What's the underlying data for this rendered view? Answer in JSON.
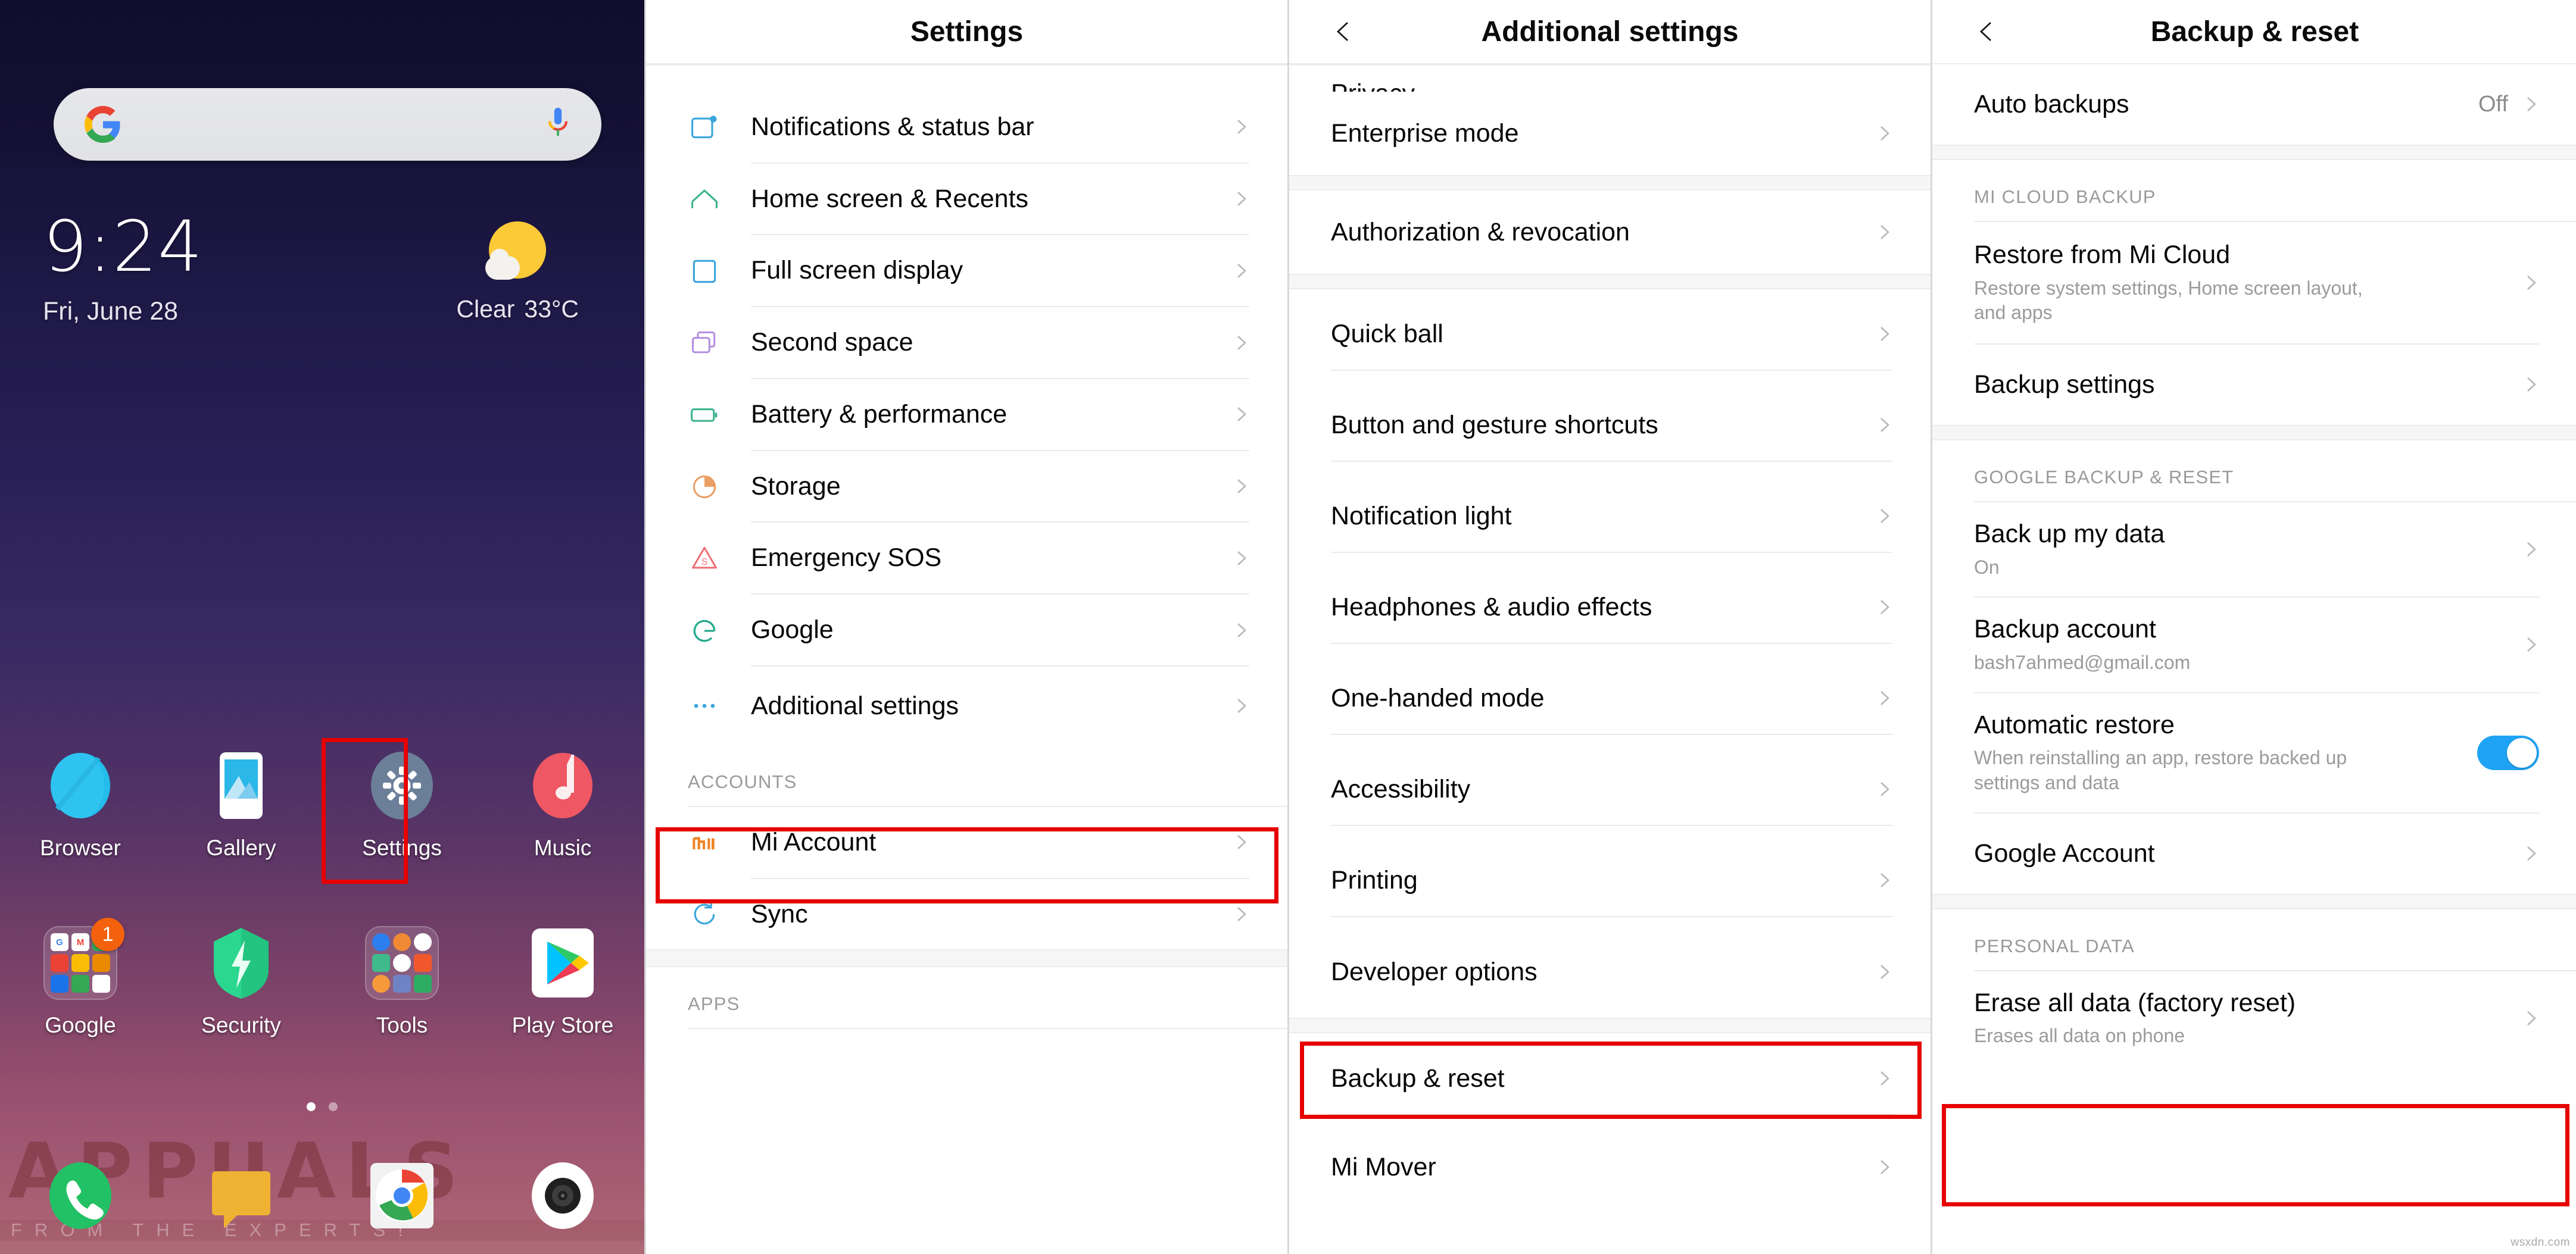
{
  "home": {
    "search": {
      "placeholder": "",
      "google_icon": "google-g-icon",
      "mic_icon": "microphone-icon"
    },
    "clock": {
      "time": "9:24",
      "date": "Fri, June 28"
    },
    "weather": {
      "condition": "Clear",
      "temperature": "33°C",
      "icon": "sun-behind-cloud-icon"
    },
    "apps_row1": [
      {
        "label": "Browser",
        "icon": "browser-icon"
      },
      {
        "label": "Gallery",
        "icon": "gallery-icon"
      },
      {
        "label": "Settings",
        "icon": "settings-gear-icon",
        "highlighted": true
      },
      {
        "label": "Music",
        "icon": "music-note-icon"
      }
    ],
    "apps_row2": [
      {
        "label": "Google",
        "icon": "google-folder-icon",
        "badge": "1"
      },
      {
        "label": "Security",
        "icon": "security-shield-icon"
      },
      {
        "label": "Tools",
        "icon": "tools-folder-icon"
      },
      {
        "label": "Play Store",
        "icon": "play-store-icon"
      }
    ],
    "dock": [
      {
        "label": "Phone",
        "icon": "phone-icon"
      },
      {
        "label": "Messaging",
        "icon": "messaging-icon"
      },
      {
        "label": "Chrome",
        "icon": "chrome-icon"
      },
      {
        "label": "Camera",
        "icon": "camera-icon"
      }
    ],
    "page_dots": {
      "count": 2,
      "active_index": 0
    },
    "watermark": {
      "main": "APPUALS",
      "sub": "FROM THE EXPERTS!"
    }
  },
  "settings": {
    "title": "Settings",
    "items": [
      {
        "label": "Notifications & status bar",
        "icon": "notifications-icon",
        "icon_color": "#3aa6dd"
      },
      {
        "label": "Home screen & Recents",
        "icon": "home-icon",
        "icon_color": "#3fb392"
      },
      {
        "label": "Full screen display",
        "icon": "full-screen-icon",
        "icon_color": "#3aa6dd"
      },
      {
        "label": "Second space",
        "icon": "second-space-icon",
        "icon_color": "#b18ce0"
      },
      {
        "label": "Battery & performance",
        "icon": "battery-icon",
        "icon_color": "#3fb392"
      },
      {
        "label": "Storage",
        "icon": "storage-pie-icon",
        "icon_color": "#eb9d63"
      },
      {
        "label": "Emergency SOS",
        "icon": "emergency-sos-icon",
        "icon_color": "#ef6d72"
      },
      {
        "label": "Google",
        "icon": "google-g-icon",
        "icon_color": "#27ab8f"
      },
      {
        "label": "Additional settings",
        "icon": "ellipsis-icon",
        "icon_color": "#3aa6dd",
        "highlighted": true
      }
    ],
    "section_accounts": "ACCOUNTS",
    "accounts_items": [
      {
        "label": "Mi Account",
        "icon": "mi-logo-icon",
        "icon_color": "#f08223"
      },
      {
        "label": "Sync",
        "icon": "sync-icon",
        "icon_color": "#3aa6dd"
      }
    ],
    "section_apps": "APPS"
  },
  "additional_settings": {
    "title": "Additional settings",
    "back_icon": "chevron-left-icon",
    "items_group1": [
      {
        "label": "Enterprise mode"
      }
    ],
    "items_group2": [
      {
        "label": "Authorization & revocation"
      }
    ],
    "items_group3": [
      {
        "label": "Quick ball"
      },
      {
        "label": "Button and gesture shortcuts"
      },
      {
        "label": "Notification light"
      },
      {
        "label": "Headphones & audio effects"
      },
      {
        "label": "One-handed mode"
      },
      {
        "label": "Accessibility"
      },
      {
        "label": "Printing"
      },
      {
        "label": "Developer options"
      }
    ],
    "items_group4": [
      {
        "label": "Backup & reset",
        "highlighted": true
      },
      {
        "label": "Mi Mover"
      }
    ]
  },
  "backup_reset": {
    "title": "Backup & reset",
    "back_icon": "chevron-left-icon",
    "auto_backups": {
      "label": "Auto backups",
      "value": "Off"
    },
    "section_mi_cloud": "MI CLOUD BACKUP",
    "mi_cloud_items": [
      {
        "label": "Restore from Mi Cloud",
        "sub": "Restore system settings, Home screen layout, and apps"
      },
      {
        "label": "Backup settings",
        "sub": ""
      }
    ],
    "section_google": "GOOGLE BACKUP & RESET",
    "google_items": [
      {
        "label": "Back up my data",
        "sub": "On"
      },
      {
        "label": "Backup account",
        "sub": "bash7ahmed@gmail.com"
      }
    ],
    "automatic_restore": {
      "label": "Automatic restore",
      "sub": "When reinstalling an app, restore backed up settings and data",
      "toggle_on": true
    },
    "google_account": {
      "label": "Google Account"
    },
    "section_personal": "PERSONAL DATA",
    "erase": {
      "label": "Erase all data (factory reset)",
      "sub": "Erases all data on phone",
      "highlighted": true
    },
    "page_watermark": "wsxdn.com"
  },
  "colors": {
    "highlight_red": "#e60000",
    "toggle_blue": "#1fa4f5",
    "header_text": "#0a0a0a",
    "sub_text": "#9b9b9b"
  }
}
